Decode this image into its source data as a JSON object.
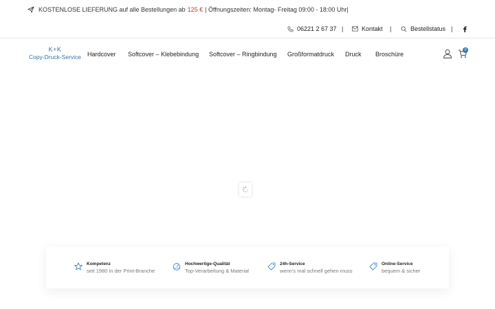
{
  "announcement": {
    "text_before": "KOSTENLOSE LIEFERUNG auf alle Bestellungen ab",
    "price": "125 €",
    "text_after": "| Öffnungszeiten: Montag- Freitag 09:00 - 18:00 Uhr|"
  },
  "contact": {
    "phone": "06221 2 67 37",
    "contact_label": "Kontakt",
    "order_status_label": "Bestellstatus",
    "separator": "|"
  },
  "logo": {
    "line1": "K+K",
    "line2": "Copy-Druck-Service"
  },
  "nav": {
    "items": [
      "Hardcover",
      "Softcover – Klebebindung",
      "Softcover – Ringbindung",
      "Großformatdruck",
      "Druck",
      "Broschüre"
    ],
    "cart_count": "0"
  },
  "features": [
    {
      "title": "Kompetenz",
      "subtitle": "seit 1980 in der Print-Branche",
      "icon": "star-icon"
    },
    {
      "title": "Hochwertige-Qualität",
      "subtitle": "Top-Verarbeitung & Material",
      "icon": "gauge-icon"
    },
    {
      "title": "24h-Service",
      "subtitle": "wenn's mal schnell gehen muss",
      "icon": "tag-icon"
    },
    {
      "title": "Online-Service",
      "subtitle": "bequem & sicher",
      "icon": "tag-outline-icon"
    }
  ],
  "colors": {
    "accent": "#2e74b5",
    "price": "#c0392b"
  }
}
